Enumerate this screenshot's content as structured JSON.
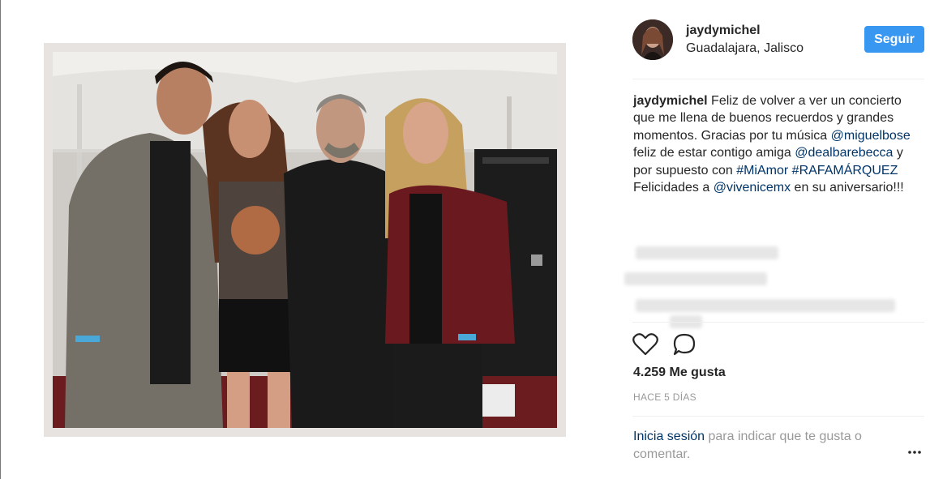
{
  "header": {
    "username": "jaydymichel",
    "location": "Guadalajara, Jalisco",
    "follow_label": "Seguir"
  },
  "caption": {
    "author": "jaydymichel",
    "text_1": " Feliz de volver a ver un concierto que me llena de buenos recuerdos y grandes momentos. Gracias por tu música ",
    "mention_1": "@miguelbose",
    "text_2": " feliz de estar contigo amiga ",
    "mention_2": "@dealbarebecca",
    "text_3": " y por supuesto con ",
    "hashtag_1": "#MiAmor",
    "text_4": " ",
    "hashtag_2": "#RAFAMÁRQUEZ",
    "text_5": " Felicidades a ",
    "mention_3": "@vivenicemx",
    "text_6": " en su aniversario!!!"
  },
  "actions": {
    "like_icon": "heart-icon",
    "comment_icon": "comment-icon",
    "more_icon": "more-options-icon"
  },
  "likes": "4.259 Me gusta",
  "timestamp": "HACE 5 DÍAS",
  "login_prompt": {
    "link": "Inicia sesión",
    "text": " para indicar que te gusta o comentar."
  },
  "colors": {
    "follow_button": "#3897f0",
    "link": "#003569",
    "muted": "#999999"
  }
}
